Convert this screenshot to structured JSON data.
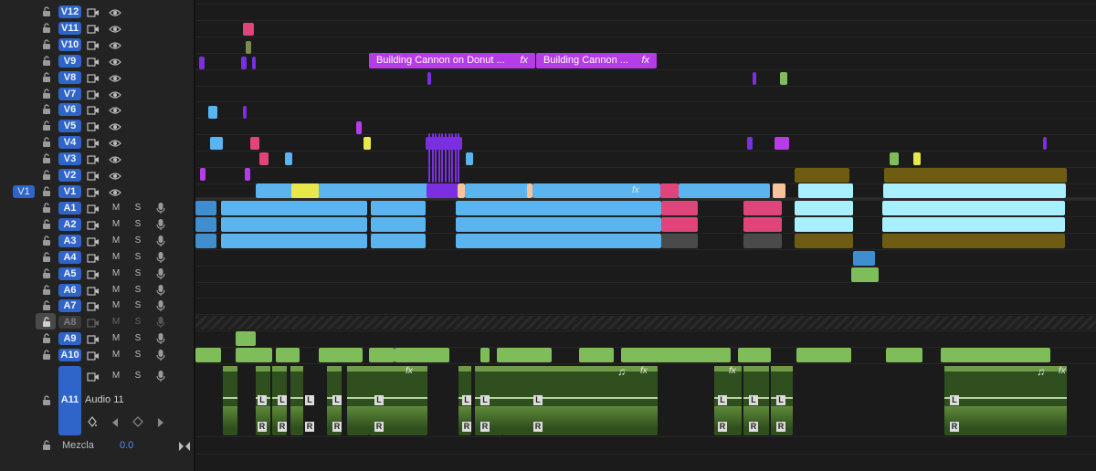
{
  "video_tracks": [
    {
      "id": "V12",
      "source": ""
    },
    {
      "id": "V11",
      "source": ""
    },
    {
      "id": "V10",
      "source": ""
    },
    {
      "id": "V9",
      "source": ""
    },
    {
      "id": "V8",
      "source": ""
    },
    {
      "id": "V7",
      "source": ""
    },
    {
      "id": "V6",
      "source": ""
    },
    {
      "id": "V5",
      "source": ""
    },
    {
      "id": "V4",
      "source": ""
    },
    {
      "id": "V3",
      "source": ""
    },
    {
      "id": "V2",
      "source": ""
    },
    {
      "id": "V1",
      "source": "V1"
    }
  ],
  "audio_tracks": [
    {
      "id": "A1",
      "locked": false
    },
    {
      "id": "A2",
      "locked": false
    },
    {
      "id": "A3",
      "locked": false
    },
    {
      "id": "A4",
      "locked": false
    },
    {
      "id": "A5",
      "locked": false
    },
    {
      "id": "A6",
      "locked": false
    },
    {
      "id": "A7",
      "locked": false
    },
    {
      "id": "A8",
      "locked": true
    },
    {
      "id": "A9",
      "locked": false
    },
    {
      "id": "A10",
      "locked": false
    }
  ],
  "audio11": {
    "id": "A11",
    "name": "Audio 11"
  },
  "mix": {
    "label": "Mezcla",
    "value": "0.0"
  },
  "labels": {
    "mute": "M",
    "solo": "S",
    "left": "L",
    "right": "R",
    "fx": "fx",
    "music": "♫"
  },
  "named_clips": [
    {
      "title": "Building Cannon on Donut ...",
      "fx": "fx"
    },
    {
      "title": "Building Cannon ...",
      "fx": "fx"
    }
  ],
  "colors": {
    "track_badge": "#2f64c8",
    "clip_blue": "#5ab4f0",
    "clip_cyan": "#a8f0ff",
    "clip_purple": "#7a2fe0",
    "clip_magenta": "#b53de6",
    "clip_olive": "#6e5c12",
    "clip_green": "#7fbd5a",
    "clip_pink": "#e0447a",
    "clip_peach": "#f6c39a",
    "clip_yellow": "#e9e84a"
  },
  "icons": [
    "lock-icon",
    "camera-icon",
    "eye-icon",
    "microphone-icon",
    "keyframe-icon",
    "prev-keyframe-icon",
    "add-keyframe-icon",
    "next-keyframe-icon",
    "mix-end-icon"
  ]
}
